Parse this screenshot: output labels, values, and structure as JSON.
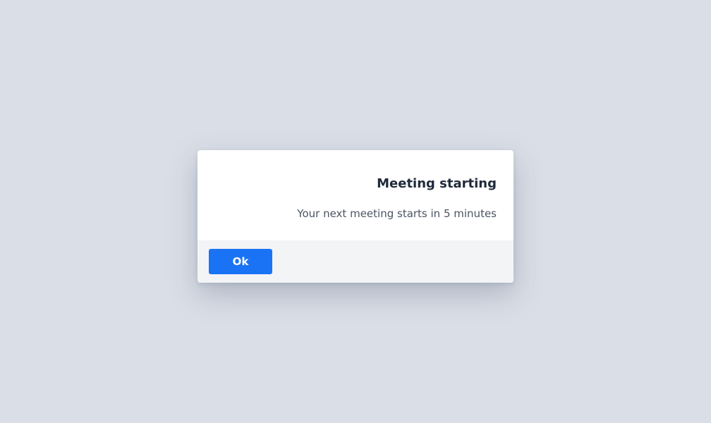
{
  "dialog": {
    "title": "Meeting starting",
    "message": "Your next meeting starts in 5 minutes",
    "ok_label": "Ok"
  },
  "colors": {
    "backdrop": "#dadee6",
    "accent": "#1a73f5",
    "footer": "#f3f4f6"
  }
}
